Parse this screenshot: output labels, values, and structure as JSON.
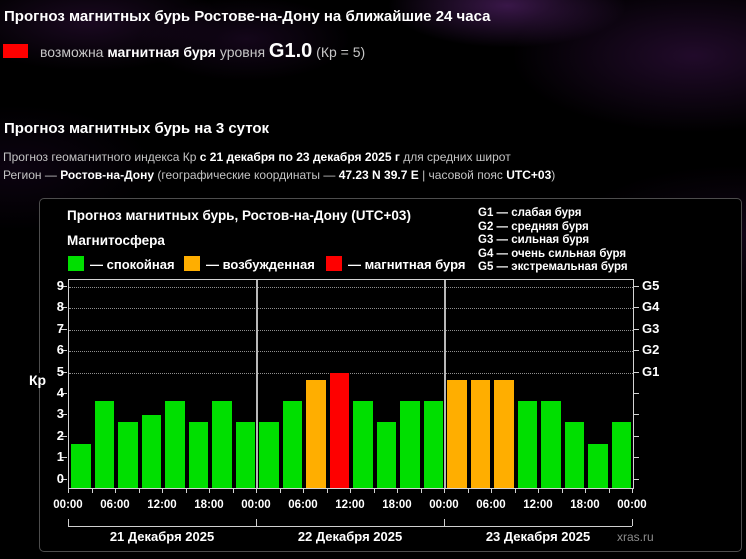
{
  "section24": {
    "title": "Прогноз магнитных бурь Ростове-на-Дону на ближайшие 24 часа",
    "alert": {
      "swatch_color": "#ff0000",
      "prefix": "возможна ",
      "storm_bold": "магнитная буря",
      "level_word": " уровня ",
      "level": "G1.0",
      "kp_note": " (Кр = 5)"
    }
  },
  "section3day": {
    "title": "Прогноз магнитных бурь на 3 суток",
    "line1": {
      "p1": "Прогноз геомагнитного индекса Кр ",
      "b1": "с 21 декабря по 23 декабря 2025 г",
      "p2": " для средних широт"
    },
    "line2": {
      "p1": "Регион — ",
      "b1": "Ростов-на-Дону",
      "p2": " (географические координаты — ",
      "b2": "47.23 N 39.7 E",
      "p3": " | часовой пояс ",
      "b3": "UTC+03",
      "p4": ")"
    }
  },
  "panel": {
    "title": "Прогноз магнитных бурь, Ростов-на-Дону (UTC+03)",
    "magnetosphere_label": "Магнитосфера",
    "legend": [
      {
        "state": "quiet",
        "label": "— спокойная",
        "color": "#00df00"
      },
      {
        "state": "excited",
        "label": "— возбужденная",
        "color": "#ffae00"
      },
      {
        "state": "storm",
        "label": "— магнитная буря",
        "color": "#fe0000"
      }
    ],
    "g_legend": [
      "G1 — слабая буря",
      "G2 — средняя буря",
      "G3 — сильная буря",
      "G4 — очень сильная буря",
      "G5 — экстремальная буря"
    ],
    "credit": "xras.ru"
  },
  "chart_data": {
    "type": "bar",
    "title": "Прогноз магнитных бурь, Ростов-на-Дону (UTC+03)",
    "ylabel": "Кр",
    "ylim": [
      0,
      9
    ],
    "yticks": [
      0,
      1,
      2,
      3,
      4,
      5,
      6,
      7,
      8,
      9
    ],
    "grid_levels_kp": [
      5,
      6,
      7,
      8,
      9
    ],
    "grid_style": "dotted",
    "legend_position": "top",
    "interval_hours": 3,
    "time_labels": [
      "00:00",
      "06:00",
      "12:00",
      "18:00",
      "00:00",
      "06:00",
      "12:00",
      "18:00",
      "00:00",
      "06:00",
      "12:00",
      "18:00",
      "00:00"
    ],
    "right_axis": [
      {
        "kp": 5,
        "label": "G1"
      },
      {
        "kp": 6,
        "label": "G2"
      },
      {
        "kp": 7,
        "label": "G3"
      },
      {
        "kp": 8,
        "label": "G4"
      },
      {
        "kp": 9,
        "label": "G5"
      }
    ],
    "state_colors": {
      "quiet": "#00df00",
      "excited": "#ffae00",
      "storm": "#fe0000"
    },
    "days": [
      {
        "date": "21 Декабря 2025",
        "kp": [
          1.67,
          3.67,
          2.67,
          3.0,
          3.67,
          2.67,
          3.67,
          2.67
        ],
        "states": [
          "quiet",
          "quiet",
          "quiet",
          "quiet",
          "quiet",
          "quiet",
          "quiet",
          "quiet"
        ]
      },
      {
        "date": "22 Декабря 2025",
        "kp": [
          2.67,
          3.67,
          4.67,
          5.0,
          3.67,
          2.67,
          3.67,
          3.67
        ],
        "states": [
          "quiet",
          "quiet",
          "excited",
          "storm",
          "quiet",
          "quiet",
          "quiet",
          "quiet"
        ]
      },
      {
        "date": "23 Декабря 2025",
        "kp": [
          4.67,
          4.67,
          4.67,
          3.67,
          3.67,
          2.67,
          1.67,
          2.67
        ],
        "states": [
          "excited",
          "excited",
          "excited",
          "quiet",
          "quiet",
          "quiet",
          "quiet",
          "quiet"
        ]
      }
    ]
  }
}
